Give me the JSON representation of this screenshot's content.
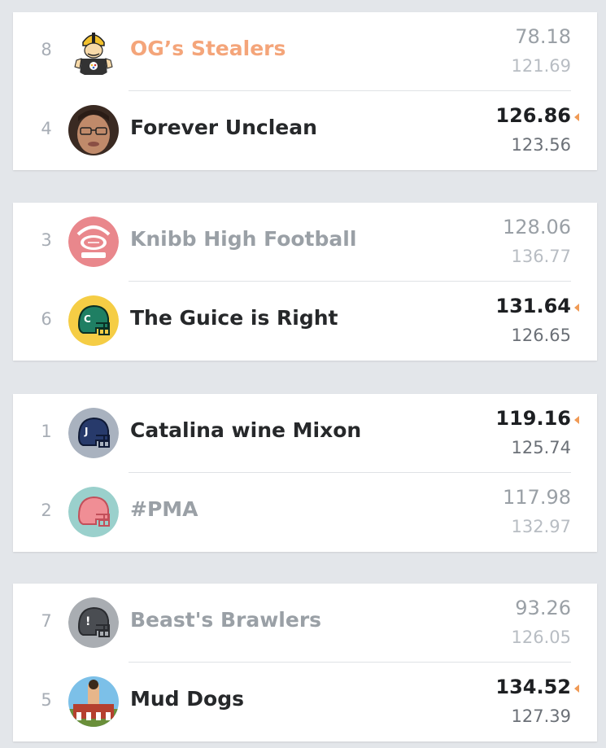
{
  "matchups": [
    {
      "teams": [
        {
          "seed": "8",
          "name": "OG’s Stealers",
          "score": "78.18",
          "projected": "121.69",
          "winner": false,
          "avatar_icon": "cartoon-mascot-icon"
        },
        {
          "seed": "4",
          "name": "Forever Unclean",
          "score": "126.86",
          "projected": "123.56",
          "winner": true,
          "avatar_icon": "person-photo-icon"
        }
      ]
    },
    {
      "teams": [
        {
          "seed": "3",
          "name": "Knibb High Football",
          "score": "128.06",
          "projected": "136.77",
          "winner": false,
          "avatar_icon": "football-logo-icon"
        },
        {
          "seed": "6",
          "name": "The Guice is Right",
          "score": "131.64",
          "projected": "126.65",
          "winner": true,
          "avatar_icon": "green-helmet-icon"
        }
      ]
    },
    {
      "teams": [
        {
          "seed": "1",
          "name": "Catalina wine Mixon",
          "score": "119.16",
          "projected": "125.74",
          "winner": true,
          "avatar_icon": "navy-helmet-icon"
        },
        {
          "seed": "2",
          "name": "#PMA",
          "score": "117.98",
          "projected": "132.97",
          "winner": false,
          "avatar_icon": "pink-helmet-icon"
        }
      ]
    },
    {
      "teams": [
        {
          "seed": "7",
          "name": "Beast's Brawlers",
          "score": "93.26",
          "projected": "126.05",
          "winner": false,
          "avatar_icon": "gray-helmet-icon"
        },
        {
          "seed": "5",
          "name": "Mud Dogs",
          "score": "134.52",
          "projected": "127.39",
          "winner": true,
          "avatar_icon": "cartoon-scene-icon"
        }
      ]
    }
  ],
  "colors": {
    "background": "#e3e6ea",
    "card": "#ffffff",
    "winner_arrow": "#f09a55",
    "highlight_name": "#f4a57a"
  }
}
